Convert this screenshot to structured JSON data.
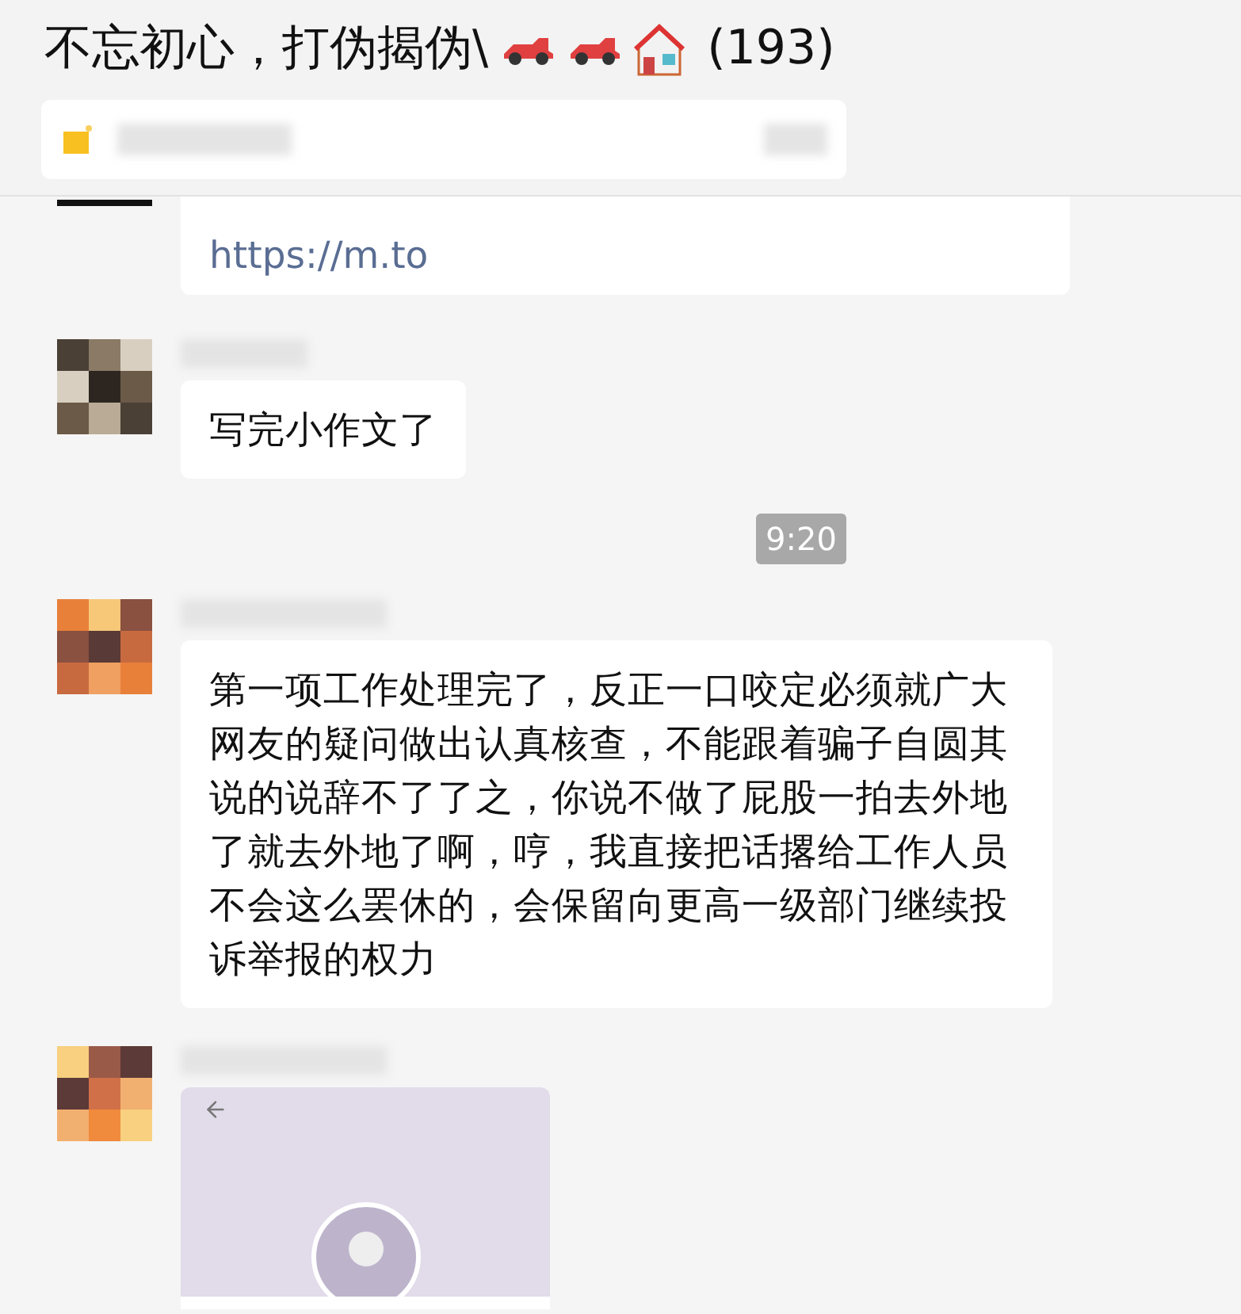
{
  "header": {
    "title": "不忘初心，打伪揭伪\\",
    "count": "(193)"
  },
  "messages": [
    {
      "kind": "link",
      "link": "https://m.to"
    },
    {
      "kind": "text",
      "text": "写完小作文了"
    },
    {
      "kind": "time",
      "text": "9:20"
    },
    {
      "kind": "text",
      "text": "第一项工作处理完了，反正一口咬定必须就广大网友的疑问做出认真核查，不能跟着骗子自圆其说的说辞不了了之，你说不做了屁股一拍去外地了就去外地了啊，哼，我直接把话撂给工作人员不会这么罢休的，会保留向更高一级部门继续投诉举报的权力"
    },
    {
      "kind": "card"
    }
  ]
}
